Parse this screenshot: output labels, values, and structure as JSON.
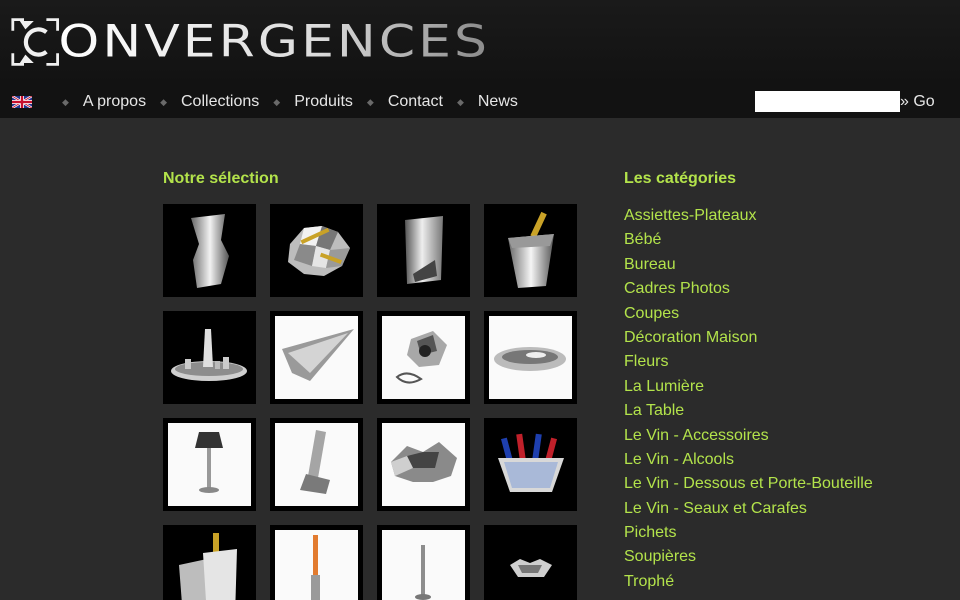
{
  "brand": {
    "name": "ONVERGENCES"
  },
  "nav": {
    "language_flag": "uk-flag-icon",
    "items": [
      "A propos",
      "Collections",
      "Produits",
      "Contact",
      "News"
    ]
  },
  "search": {
    "value": "",
    "go_label": "» Go"
  },
  "selection": {
    "title": "Notre sélection",
    "products": [
      {
        "icon": "vase-icon"
      },
      {
        "icon": "faceted-bowl-icon"
      },
      {
        "icon": "wine-cooler-icon"
      },
      {
        "icon": "champagne-bucket-icon"
      },
      {
        "icon": "tray-icon"
      },
      {
        "icon": "leaf-dish-icon"
      },
      {
        "icon": "pitcher-icon"
      },
      {
        "icon": "oval-dish-icon"
      },
      {
        "icon": "lamp-icon"
      },
      {
        "icon": "sculpture-icon"
      },
      {
        "icon": "star-bowl-icon"
      },
      {
        "icon": "ice-bucket-icon"
      },
      {
        "icon": "bottle-cooler-icon"
      },
      {
        "icon": "candlestick-icon"
      },
      {
        "icon": "candle-holder-icon"
      },
      {
        "icon": "small-bowl-icon"
      }
    ]
  },
  "categories": {
    "title": "Les catégories",
    "items": [
      "Assiettes-Plateaux",
      "Bébé",
      "Bureau",
      "Cadres Photos",
      "Coupes",
      "Décoration Maison",
      "Fleurs",
      "La Lumière",
      "La Table",
      "Le Vin - Accessoires",
      "Le Vin - Alcools",
      "Le Vin - Dessous et Porte-Bouteille",
      "Le Vin - Seaux et Carafes",
      "Pichets",
      "Soupières",
      "Trophé"
    ]
  },
  "colors": {
    "accent": "#b3e34b",
    "background": "#2b2b2b",
    "header": "#121212"
  }
}
